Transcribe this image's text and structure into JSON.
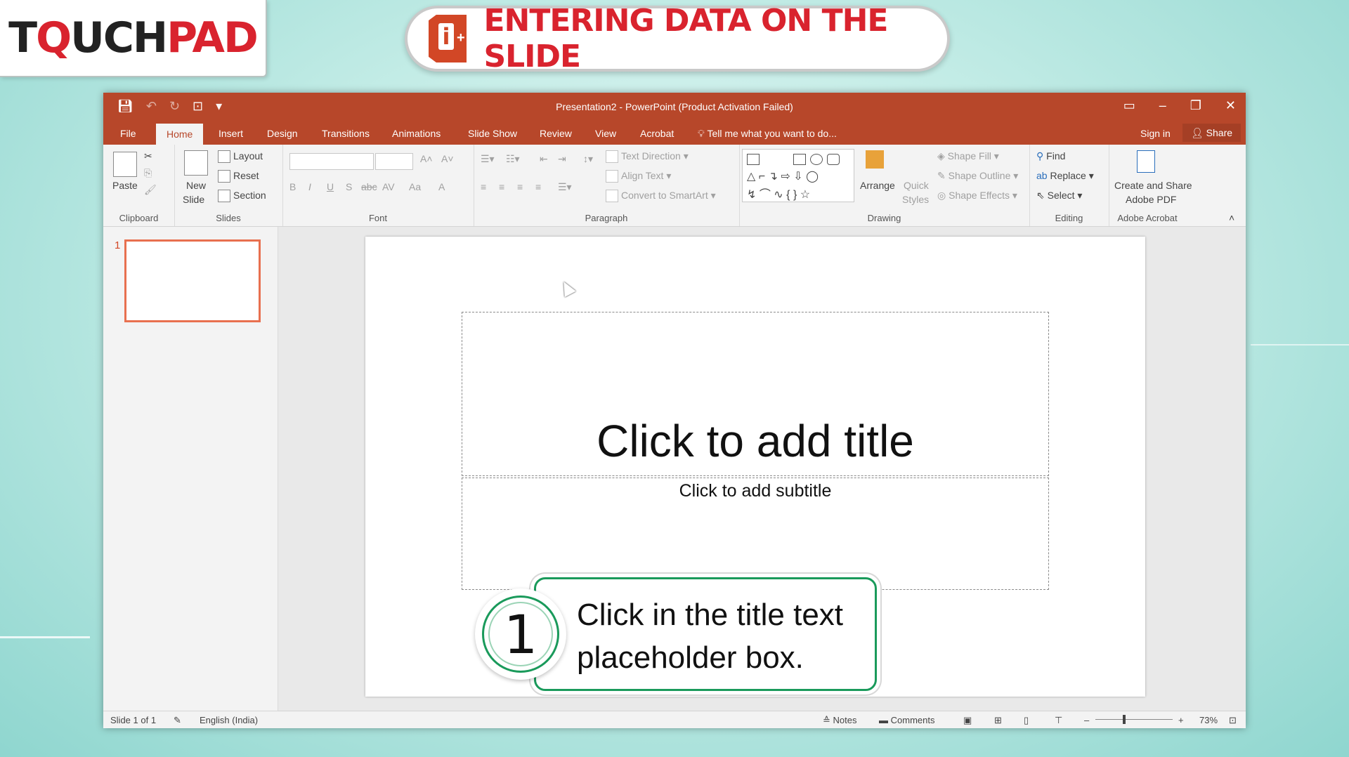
{
  "brand": {
    "logo_part1": "T",
    "logo_part2": "Q",
    "logo_part3": "UCH",
    "logo_part4": "PAD"
  },
  "header": {
    "title": "ENTERING DATA ON THE SLIDE",
    "icon": "powerpoint-add-icon"
  },
  "window": {
    "title": "Presentation2 - PowerPoint (Product Activation Failed)",
    "tabs": [
      "File",
      "Home",
      "Insert",
      "Design",
      "Transitions",
      "Animations",
      "Slide Show",
      "Review",
      "View",
      "Acrobat"
    ],
    "active_tab": "Home",
    "tell_me": "Tell me what you want to do...",
    "sign_in": "Sign in",
    "share": "Share"
  },
  "ribbon": {
    "clipboard": {
      "paste": "Paste",
      "label": "Clipboard"
    },
    "slides": {
      "new_slide_1": "New",
      "new_slide_2": "Slide",
      "layout": "Layout",
      "reset": "Reset",
      "section": "Section",
      "label": "Slides"
    },
    "font": {
      "label": "Font",
      "bold": "B",
      "italic": "I",
      "underline": "U",
      "shadow": "S",
      "strike": "abc",
      "spacing": "AV",
      "case": "Aa",
      "color": "A"
    },
    "paragraph": {
      "label": "Paragraph",
      "text_direction": "Text Direction",
      "align_text": "Align Text",
      "convert_smartart": "Convert to SmartArt"
    },
    "drawing": {
      "label": "Drawing",
      "arrange": "Arrange",
      "quick_1": "Quick",
      "quick_2": "Styles",
      "shape_fill": "Shape Fill",
      "shape_outline": "Shape Outline",
      "shape_effects": "Shape Effects"
    },
    "editing": {
      "label": "Editing",
      "find": "Find",
      "replace": "Replace",
      "select": "Select"
    },
    "acrobat": {
      "label": "Adobe Acrobat",
      "create_1": "Create and Share",
      "create_2": "Adobe PDF"
    }
  },
  "thumbnails": {
    "slide_number": "1"
  },
  "slide": {
    "title_placeholder": "Click to add title",
    "subtitle_placeholder": "Click to add subtitle"
  },
  "statusbar": {
    "slide_info": "Slide 1 of 1",
    "language": "English (India)",
    "notes": "Notes",
    "comments": "Comments",
    "zoom": "73%"
  },
  "callout": {
    "step": "1",
    "text": "Click in the title text placeholder box."
  },
  "colors": {
    "accent": "#b7472a",
    "brand_red": "#d9232e",
    "callout_green": "#1a9a5b"
  }
}
